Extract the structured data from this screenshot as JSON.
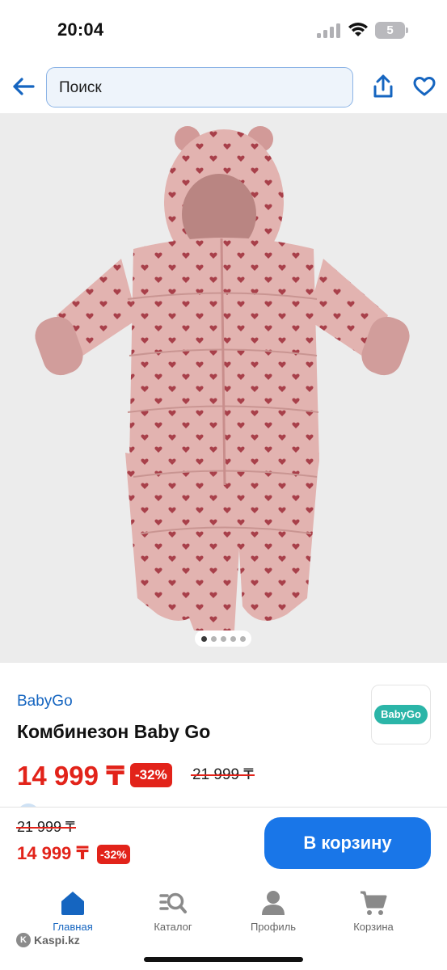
{
  "status_bar": {
    "time": "20:04",
    "battery_level": "5",
    "icons": [
      "signal-icon",
      "wifi-icon",
      "battery-icon"
    ]
  },
  "header": {
    "search_placeholder": "Поиск",
    "icons": [
      "back-arrow-icon",
      "share-icon",
      "heart-icon"
    ],
    "accent_color": "#1565c0"
  },
  "gallery": {
    "photo_count": 5,
    "active_index": 0
  },
  "product": {
    "brand": "BabyGo",
    "brand_logo_text": "BabyGo",
    "title": "Комбинезон Baby Go",
    "price": "14 999 ₸",
    "discount": "-32%",
    "old_price": "21 999 ₸"
  },
  "buy_bar": {
    "old_price": "21 999 ₸",
    "price": "14 999 ₸",
    "discount": "-32%",
    "button_label": "В корзину",
    "button_color": "#1976e8"
  },
  "tabbar": {
    "tabs": [
      {
        "label": "Главная",
        "icon": "home-icon",
        "active": true
      },
      {
        "label": "Каталог",
        "icon": "catalog-icon",
        "active": false
      },
      {
        "label": "Профиль",
        "icon": "profile-icon",
        "active": false
      },
      {
        "label": "Корзина",
        "icon": "cart-icon",
        "active": false
      }
    ]
  },
  "watermark": "Kaspi.kz",
  "colors": {
    "price_red": "#e2231a",
    "link_blue": "#1565c0"
  }
}
